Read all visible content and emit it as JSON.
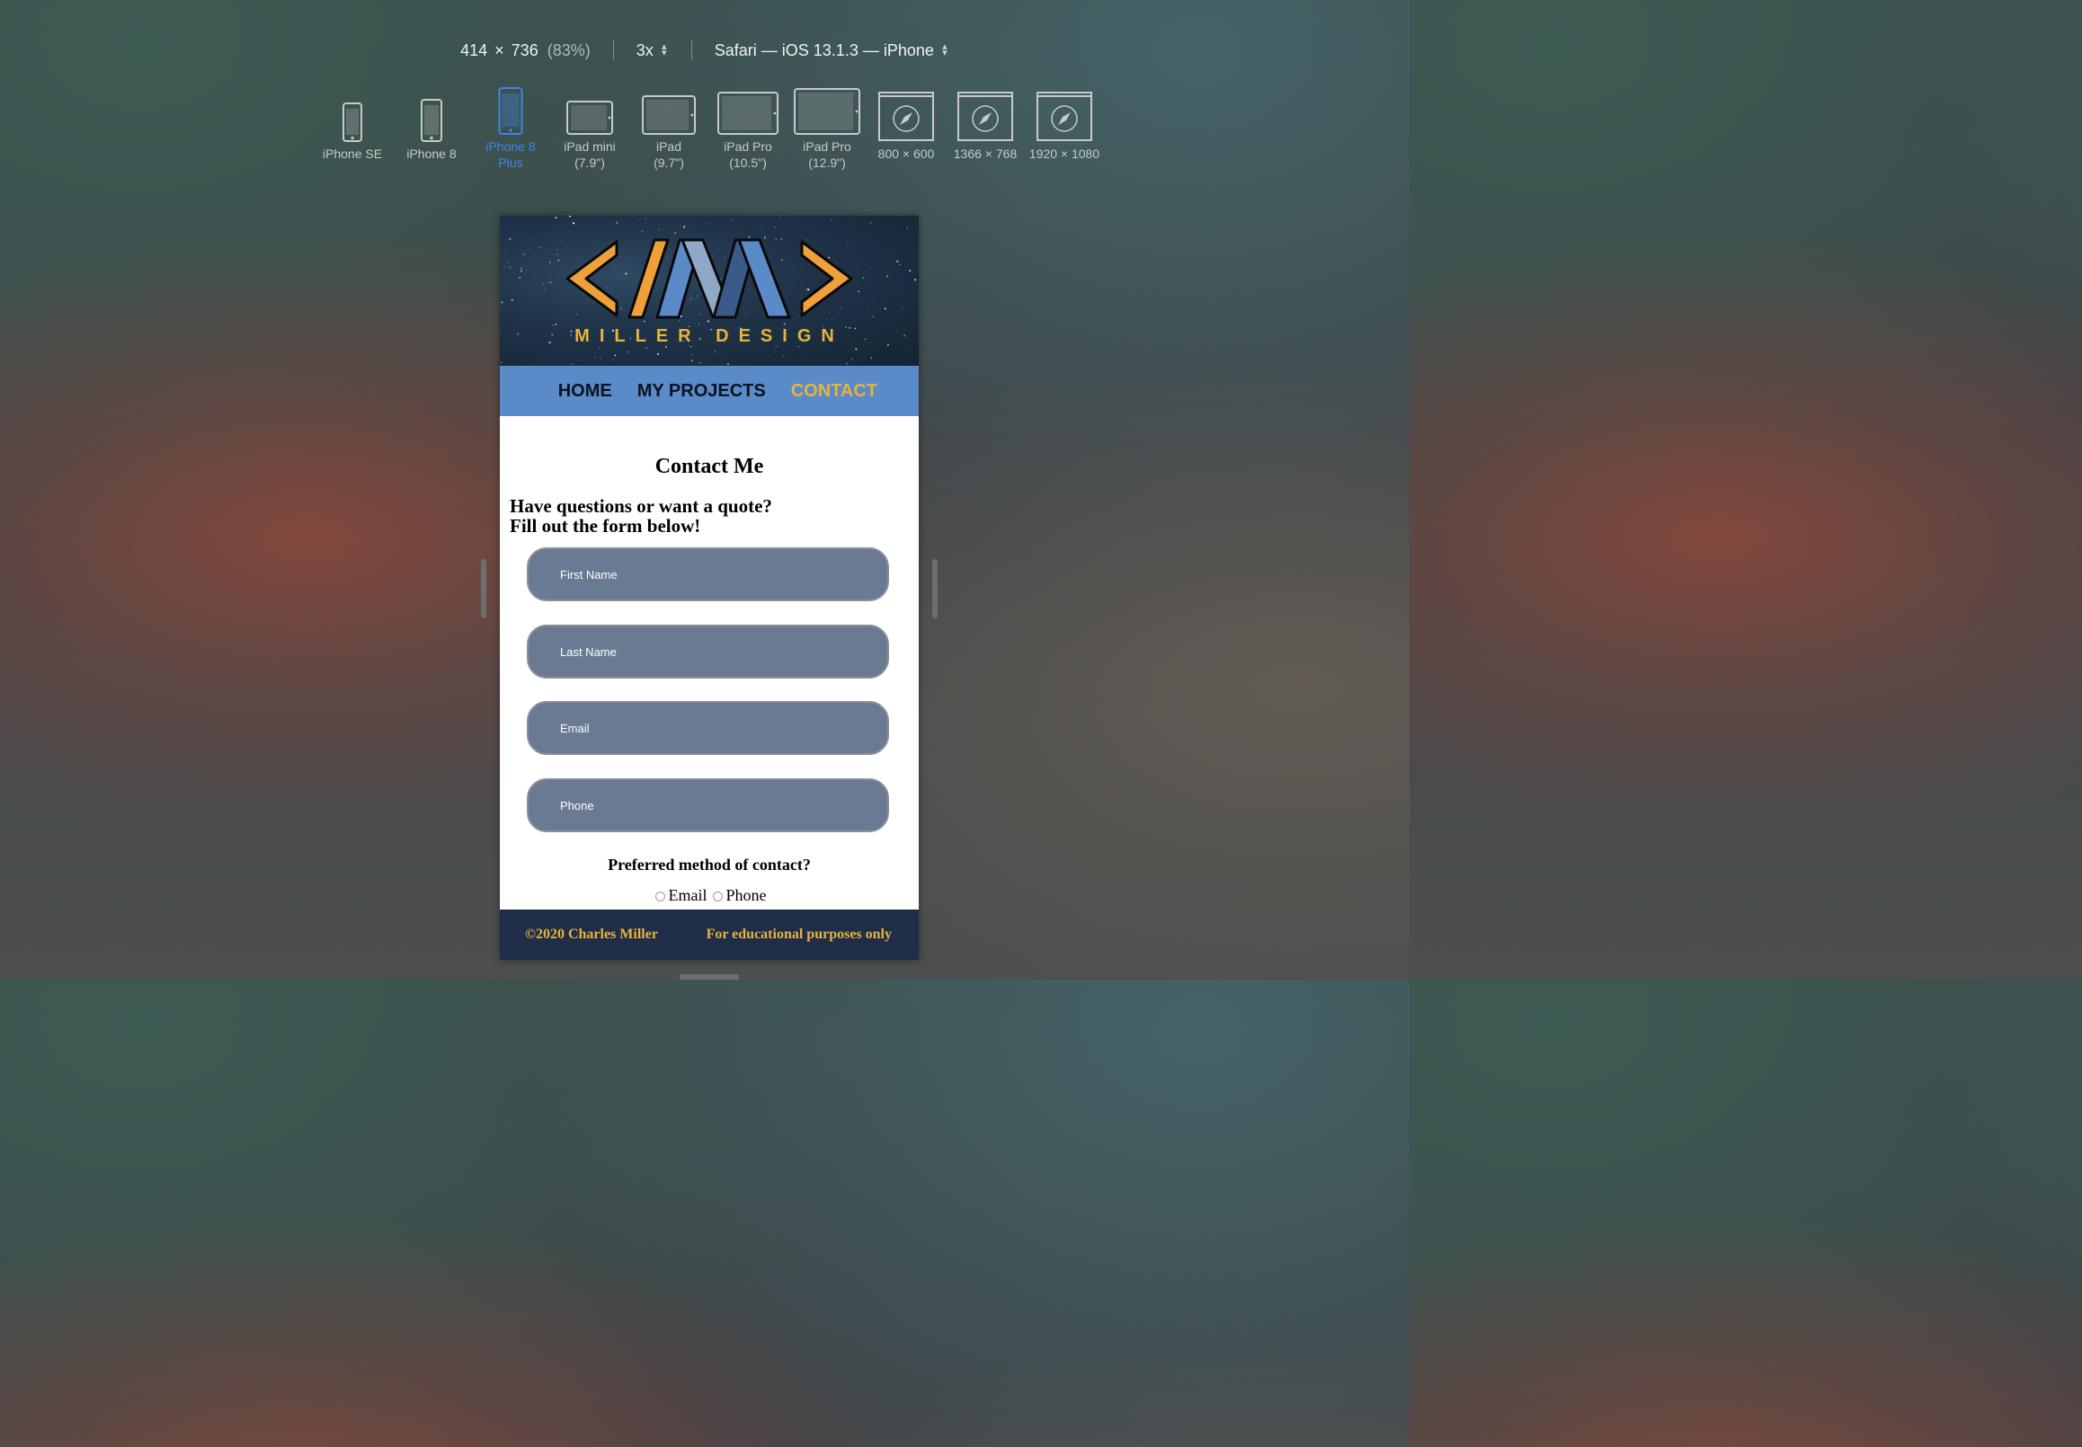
{
  "toolbar": {
    "width": "414",
    "times": "×",
    "height": "736",
    "zoom": "(83%)",
    "scale": "3x",
    "browser": "Safari — iOS 13.1.3 — iPhone"
  },
  "devices": [
    {
      "label": "iPhone SE",
      "icon": "phone-icon"
    },
    {
      "label": "iPhone 8",
      "icon": "phone-icon"
    },
    {
      "label": "iPhone 8\nPlus",
      "icon": "phone-icon",
      "active": true
    },
    {
      "label": "iPad mini\n(7.9\")",
      "icon": "tablet-icon"
    },
    {
      "label": "iPad\n(9.7\")",
      "icon": "tablet-icon"
    },
    {
      "label": "iPad Pro\n(10.5\")",
      "icon": "tablet-icon"
    },
    {
      "label": "iPad Pro\n(12.9\")",
      "icon": "tablet-icon"
    },
    {
      "label": "800 × 600",
      "icon": "safari-icon"
    },
    {
      "label": "1366 × 768",
      "icon": "safari-icon"
    },
    {
      "label": "1920 × 1080",
      "icon": "safari-icon"
    }
  ],
  "site": {
    "logo_text": "MILLER DESIGN",
    "nav": [
      {
        "label": "HOME"
      },
      {
        "label": "MY PROJECTS"
      },
      {
        "label": "CONTACT",
        "active": true
      }
    ],
    "heading": "Contact Me",
    "intro_line1": "Have questions or want a quote?",
    "intro_line2": "Fill out the form below!",
    "fields": [
      {
        "placeholder": "First Name"
      },
      {
        "placeholder": "Last Name"
      },
      {
        "placeholder": "Email"
      },
      {
        "placeholder": "Phone"
      }
    ],
    "preferred_label": "Preferred method of contact?",
    "options": [
      "Email",
      "Phone"
    ],
    "footer_left": "©2020 Charles Miller",
    "footer_right": "For educational purposes only"
  },
  "colors": {
    "accent_blue": "#3d86e8",
    "nav_bg": "#5b8ac9",
    "gold": "#e6b43c",
    "field_bg": "#6a7a93",
    "footer_bg": "#1f2d48"
  }
}
